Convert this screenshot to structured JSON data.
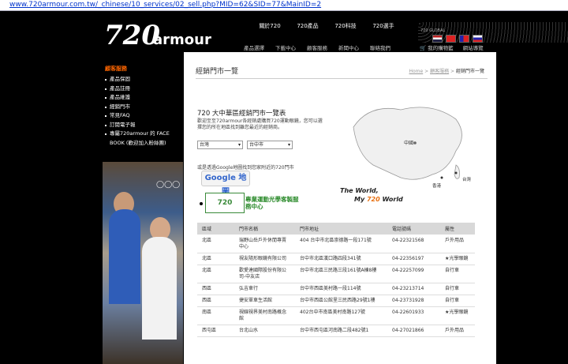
{
  "url": "www.720armour.com.tw/_chinese/10_services/02_sell.php?MID=62&SID=77&MainID=2",
  "brand": {
    "logo_text": "720armour"
  },
  "top_nav": [
    "關於720",
    "720產品",
    "720科技",
    "720選手"
  ],
  "sub_nav": [
    "產品選擇",
    "下載中心",
    "顧客服務",
    "新聞中心",
    "聯絡我們"
  ],
  "util_links": [
    "我的購物籃",
    "網站導覽"
  ],
  "globe_label": "720 GLOBAL",
  "sidebar": {
    "title": "顧客服務",
    "items": [
      "產品保固",
      "產品註冊",
      "產品維護",
      "經銷門市",
      "常見FAQ",
      "訂閱電子報",
      "專屬720armour 的 FACE BOOK (歡迎加入粉絲團)"
    ]
  },
  "page": {
    "title": "經銷門市一覽",
    "breadcrumb": {
      "home": "Home",
      "sep": ">",
      "parent": "顧客服務",
      "current": "經銷門市一覽"
    },
    "section_title": "720 大中華區經銷門市一覽表",
    "description": "歡迎至至720armour各經銷處購買720運動眼鏡，您可以選擇您的所在地區找到離您最近的經銷商。",
    "region_select": "台灣",
    "city_select": "台中市",
    "google_text": "或是透過Google地圖找到您家附近的720門市",
    "google_button": "Google 地圖",
    "promo_badge": "720",
    "promo_text": "專業運動光學客製服務中心",
    "map_labels": {
      "china": "中國",
      "hk": "香港",
      "tw": "台灣"
    },
    "slogan_line1": "The World,",
    "slogan_my": "My",
    "slogan_720": "720",
    "slogan_world": "World"
  },
  "table": {
    "headers": [
      "區域",
      "門市名稱",
      "門市地址",
      "電話號碼",
      "屬性"
    ],
    "rows": [
      [
        "北區",
        "瑞野山岳戶外休閒專賣中心",
        "404 台中市北區崇德路一段171號",
        "04-22321568",
        "戶外用品"
      ],
      [
        "北區",
        "視友隨形眼鏡有限公司",
        "台中市北區漢口路四段341號",
        "04-22356197",
        "★光學眼鏡"
      ],
      [
        "北區",
        "歡愛達國際股份有限公司-中友店",
        "台中市北區三民路三段161號A棟8樓",
        "04-22257099",
        "自行車"
      ],
      [
        "西區",
        "弘吉車行",
        "台中市西區美村路一段114號",
        "04-23213714",
        "自行車"
      ],
      [
        "西區",
        "捷安單車生活館",
        "台中市西區公館里三民西路29號1樓",
        "04-23731928",
        "自行車"
      ],
      [
        "南區",
        "視線視界美村南路概念館",
        "402台中市南區美村南路127號",
        "04-22601933",
        "★光學眼鏡"
      ],
      [
        "西屯區",
        "台北山水",
        "台中市西屯區河南路二段482號1",
        "04-27021866",
        "戶外用品"
      ]
    ]
  },
  "colors": {
    "accent": "#ff6600",
    "header_bg": "#000000",
    "green": "#2a8a2a"
  }
}
